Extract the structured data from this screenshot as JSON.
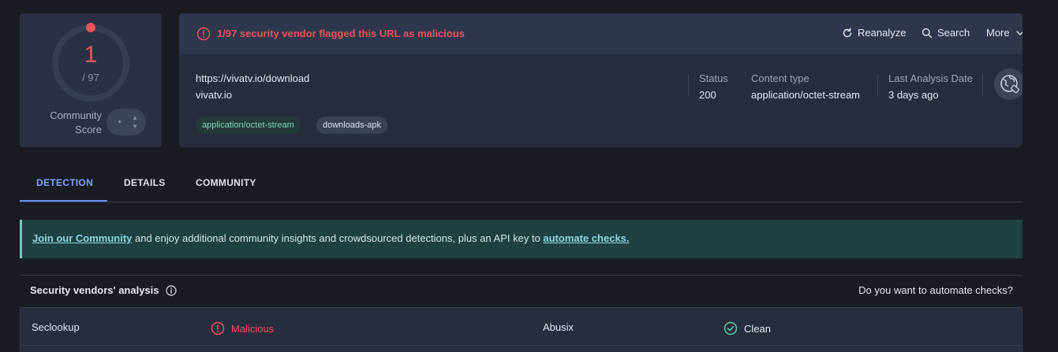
{
  "score": {
    "detections": "1",
    "total": "/ 97",
    "community_label_line1": "Community",
    "community_label_line2": "Score",
    "detection_fraction": 0.0103
  },
  "alert": {
    "text": "1/97 security vendor flagged this URL as malicious",
    "color": "#e9545a"
  },
  "actions": {
    "reanalyze": "Reanalyze",
    "search": "Search",
    "more": "More"
  },
  "target": {
    "url": "https://vivatv.io/download",
    "domain": "vivatv.io",
    "tags": [
      "application/octet-stream",
      "downloads-apk"
    ]
  },
  "meta": {
    "status_label": "Status",
    "status_value": "200",
    "content_type_label": "Content type",
    "content_type_value": "application/octet-stream",
    "last_analysis_label": "Last Analysis Date",
    "last_analysis_value": "3 days ago"
  },
  "tabs": [
    "DETECTION",
    "DETAILS",
    "COMMUNITY"
  ],
  "banner": {
    "link1": "Join our Community",
    "middle": " and enjoy additional community insights and crowdsourced detections, plus an API key to ",
    "link2": "automate checks."
  },
  "vendors": {
    "title": "Security vendors' analysis",
    "automate_link": "Do you want to automate checks?",
    "rows": [
      {
        "vendor1": "Seclookup",
        "result1": "Malicious",
        "vendor2": "Abusix",
        "result2": "Clean"
      }
    ]
  },
  "colors": {
    "accent_blue": "#7ea6ff",
    "malicious_red": "#e9545a",
    "clean_green": "#5fc9a0",
    "banner_bg": "#1e4141"
  }
}
